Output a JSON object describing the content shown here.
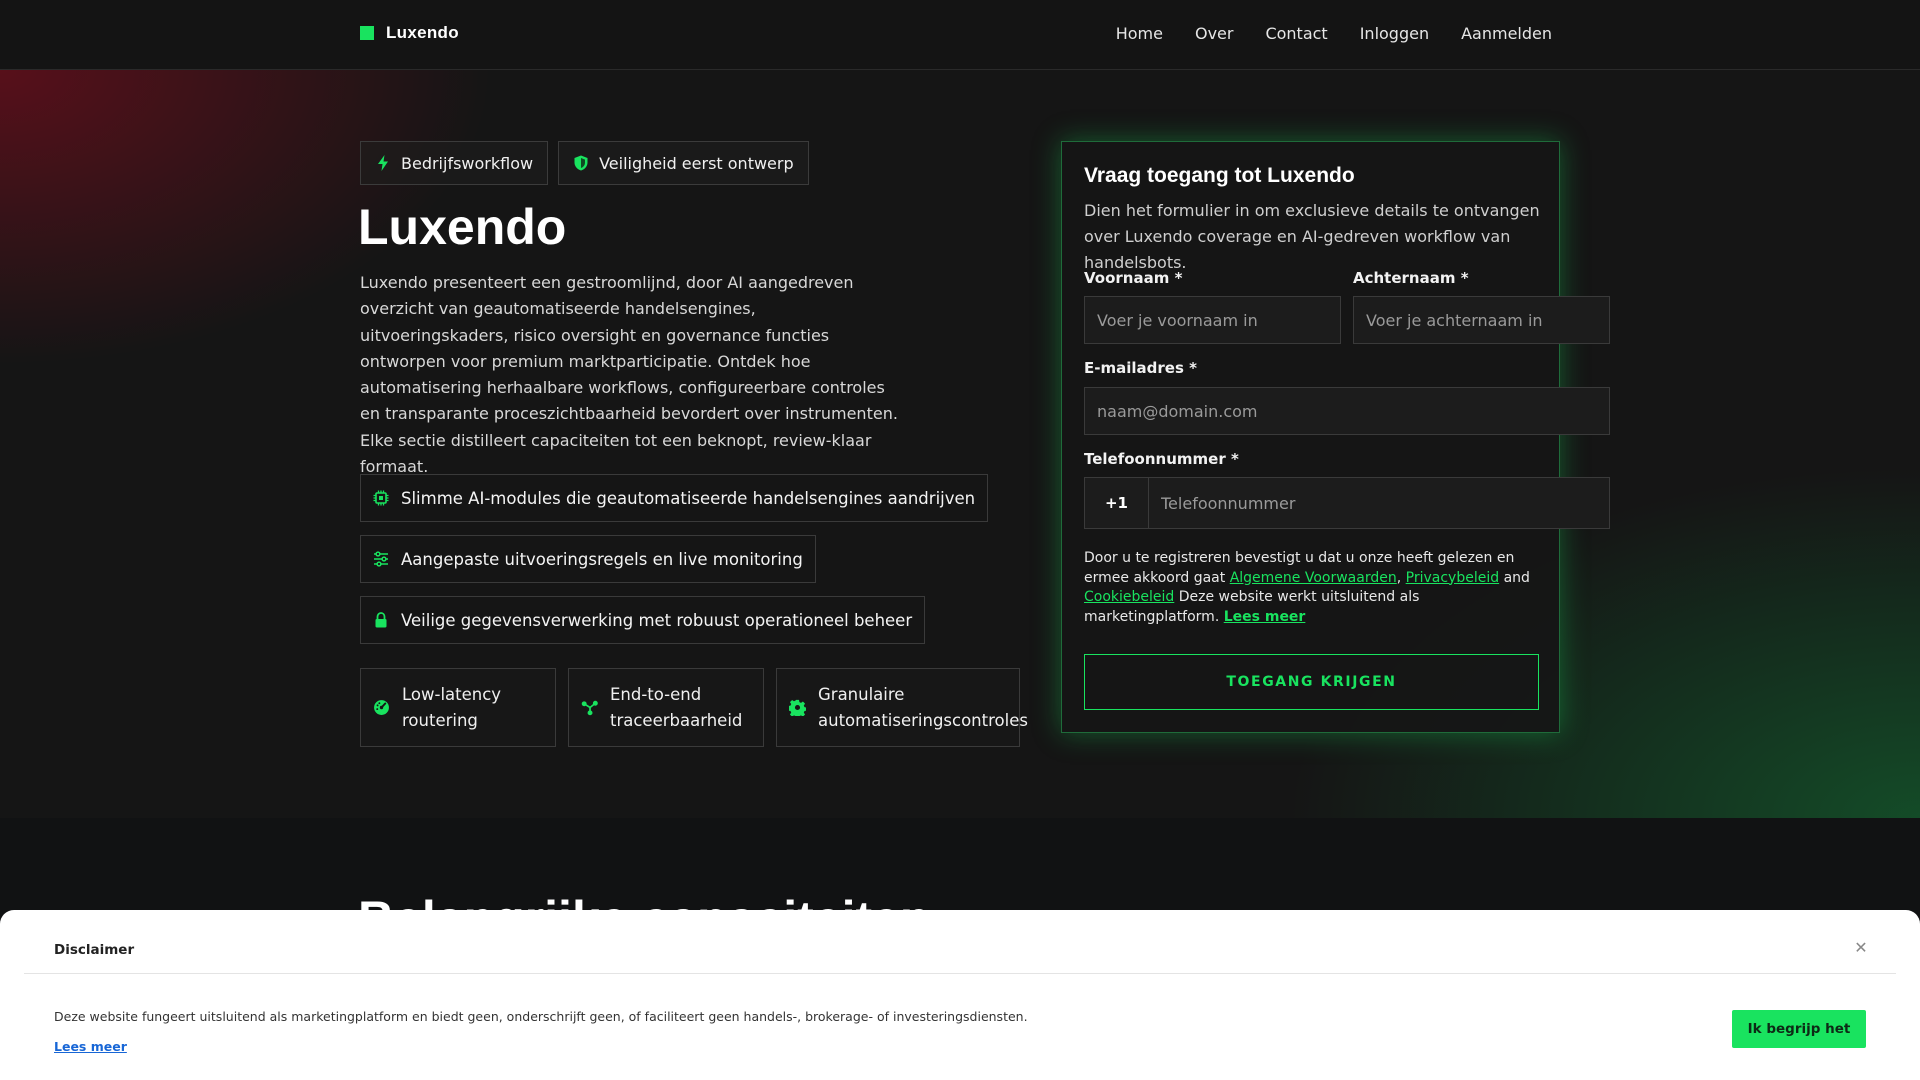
{
  "brand": {
    "name": "Luxendo"
  },
  "nav": {
    "items": [
      "Home",
      "Over",
      "Contact",
      "Inloggen",
      "Aanmelden"
    ]
  },
  "hero": {
    "badges": [
      {
        "label": "Bedrijfsworkflow",
        "icon": "bolt-icon"
      },
      {
        "label": "Veiligheid eerst ontwerp",
        "icon": "shield-icon"
      }
    ],
    "title": "Luxendo",
    "description": "Luxendo presenteert een gestroomlijnd, door AI aangedreven overzicht van geautomatiseerde handelsengines, uitvoeringskaders, risico oversight en governance functies ontworpen voor premium marktparticipatie. Ontdek hoe automatisering herhaalbare workflows, configureerbare controles en transparante proceszichtbaarheid bevordert over instrumenten. Elke sectie distilleert capaciteiten tot een beknopt, review-klaar formaat.",
    "features": [
      {
        "label": "Slimme AI-modules die geautomatiseerde handelsengines aandrijven",
        "icon": "chip-icon"
      },
      {
        "label": "Aangepaste uitvoeringsregels en live monitoring",
        "icon": "sliders-icon"
      },
      {
        "label": "Veilige gegevensverwerking met robuust operationeel beheer",
        "icon": "lock-icon"
      }
    ],
    "stats": [
      {
        "line1": "Low-latency",
        "line2": "routering",
        "icon": "gauge-icon"
      },
      {
        "line1": "End-to-end",
        "line2": "traceerbaarheid",
        "icon": "share-nodes-icon"
      },
      {
        "line1": "Granulaire",
        "line2": "automatiseringscontroles",
        "icon": "gear-icon"
      }
    ]
  },
  "form": {
    "title": "Vraag toegang tot Luxendo",
    "subtitle": "Dien het formulier in om exclusieve details te ontvangen over Luxendo coverage en AI-gedreven workflow van handelsbots.",
    "first_name": {
      "label": "Voornaam *",
      "placeholder": "Voer je voornaam in",
      "value": ""
    },
    "last_name": {
      "label": "Achternaam *",
      "placeholder": "Voer je achternaam in",
      "value": ""
    },
    "email": {
      "label": "E-mailadres *",
      "placeholder": "naam@domain.com",
      "value": ""
    },
    "phone": {
      "label": "Telefoonnummer *",
      "prefix": "+1",
      "placeholder": "Telefoonnummer",
      "value": ""
    },
    "consent": {
      "prefix": "Door u te registreren bevestigt u dat u onze heeft gelezen en ermee akkoord gaat",
      "terms": "Algemene Voorwaarden",
      "comma": ",",
      "privacy": "Privacybeleid",
      "and": "and",
      "cookies": "Cookiebeleid",
      "suffix": "Deze website werkt uitsluitend als marketingplatform.",
      "read_more": "Lees meer"
    },
    "submit_label": "TOEGANG KRIJGEN"
  },
  "next_section": {
    "heading_peek": "Belangrijke capaciteiten"
  },
  "disclaimer": {
    "title": "Disclaimer",
    "close_icon": "close-icon",
    "text": "Deze website fungeert uitsluitend als marketingplatform en biedt geen, onderschrijft geen, of faciliteert geen handels-, brokerage- of investeringsdiensten.",
    "link": "Lees meer",
    "button": "Ik begrijp het"
  },
  "colors": {
    "accent": "#19e35f",
    "background": "#151515",
    "link_blue": "#1766d6"
  }
}
